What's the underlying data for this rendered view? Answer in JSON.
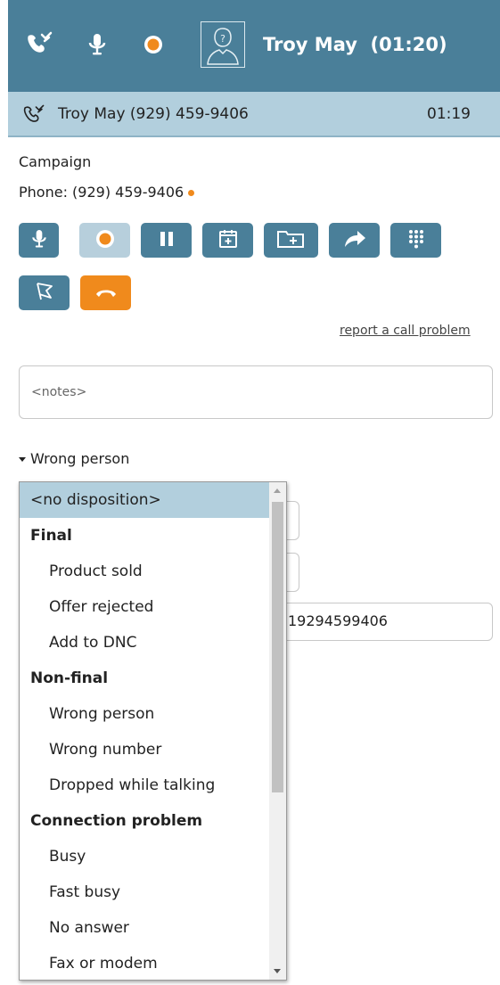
{
  "header": {
    "title": "Troy May  (01:20)",
    "icons": [
      "phone-hand-icon",
      "microphone-icon",
      "record-icon",
      "unknown-person-avatar-icon"
    ]
  },
  "call_bar": {
    "text": "Troy May (929) 459-9406",
    "time": "01:19",
    "icon": "phone-hand-icon"
  },
  "info": {
    "campaign_label": "Campaign",
    "phone_label": "Phone:  (929) 459-9406"
  },
  "toolbar": {
    "buttons": [
      "microphone-icon",
      "record-icon",
      "pause-icon",
      "calendar-add-icon",
      "folder-add-icon",
      "transfer-arrow-icon",
      "keypad-icon",
      "flag-icon",
      "hangup-icon"
    ]
  },
  "report_link": "report a call problem",
  "notes": {
    "placeholder": "<notes>"
  },
  "disposition": {
    "toggle_label": "Wrong person",
    "hidden_field_value": "19294599406",
    "options": [
      {
        "label": "<no disposition>",
        "kind": "selected"
      },
      {
        "label": "Final",
        "kind": "group"
      },
      {
        "label": "Product sold",
        "kind": "item"
      },
      {
        "label": "Offer rejected",
        "kind": "item"
      },
      {
        "label": "Add to DNC",
        "kind": "item"
      },
      {
        "label": "Non-final",
        "kind": "group"
      },
      {
        "label": "Wrong person",
        "kind": "item"
      },
      {
        "label": "Wrong number",
        "kind": "item"
      },
      {
        "label": "Dropped while talking",
        "kind": "item"
      },
      {
        "label": "Connection problem",
        "kind": "group"
      },
      {
        "label": "Busy",
        "kind": "item"
      },
      {
        "label": "Fast busy",
        "kind": "item"
      },
      {
        "label": "No answer",
        "kind": "item"
      },
      {
        "label": "Fax or modem",
        "kind": "item"
      }
    ]
  },
  "colors": {
    "header": "#4a7f99",
    "callbar": "#b2cfdd",
    "accent_orange": "#f08a1c",
    "button": "#4a7f99"
  }
}
